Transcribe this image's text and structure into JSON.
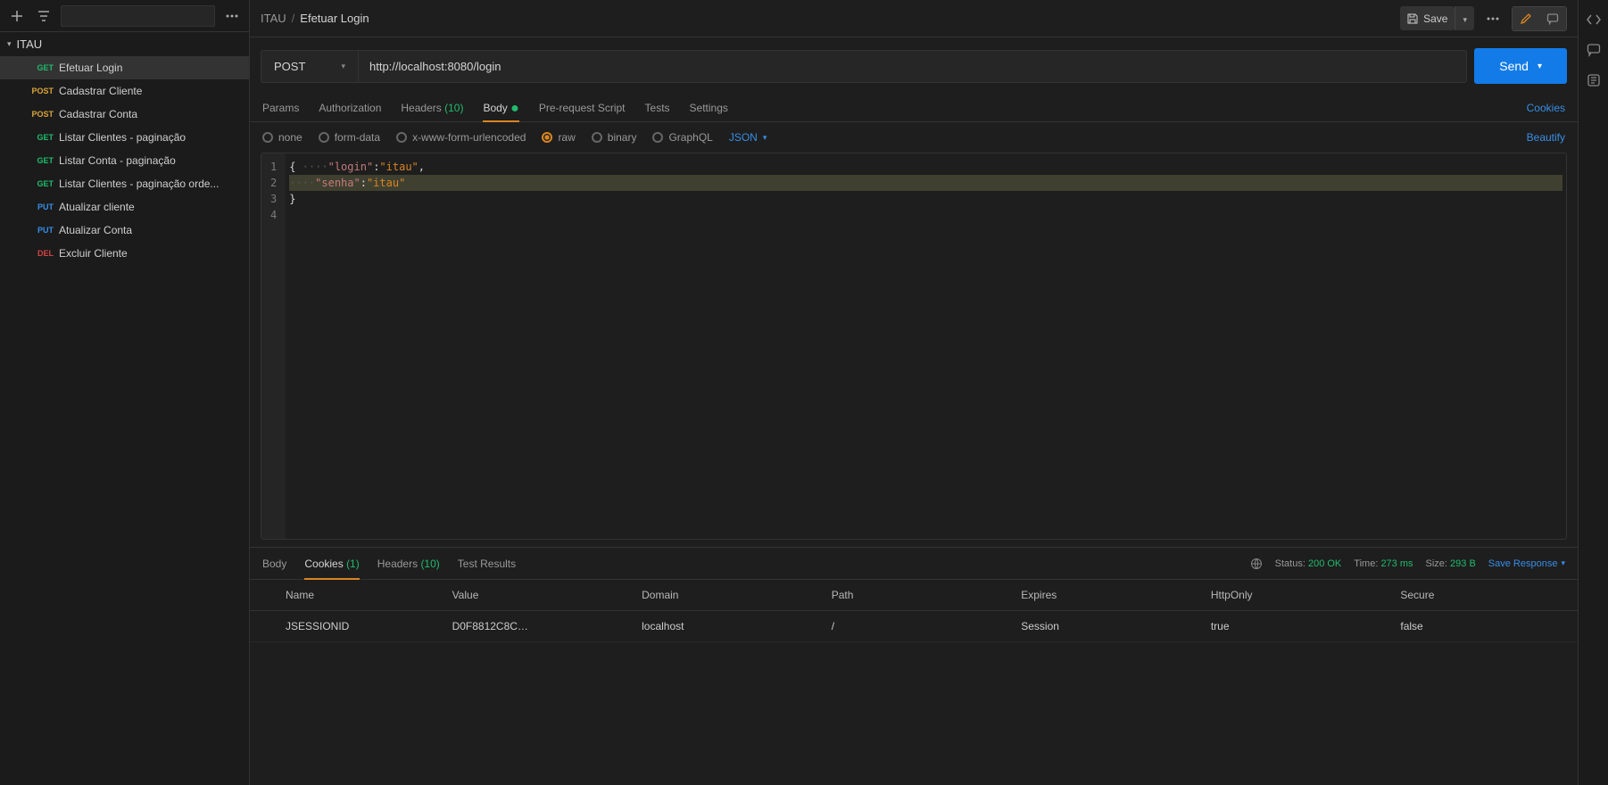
{
  "sidebar": {
    "collection_name": "ITAU",
    "items": [
      {
        "method": "GET",
        "label": "Efetuar Login",
        "active": true
      },
      {
        "method": "POST",
        "label": "Cadastrar Cliente"
      },
      {
        "method": "POST",
        "label": "Cadastrar Conta"
      },
      {
        "method": "GET",
        "label": "Listar Clientes - paginação"
      },
      {
        "method": "GET",
        "label": "Listar Conta - paginação"
      },
      {
        "method": "GET",
        "label": "Listar Clientes - paginação orde..."
      },
      {
        "method": "PUT",
        "label": "Atualizar cliente"
      },
      {
        "method": "PUT",
        "label": "Atualizar Conta"
      },
      {
        "method": "DEL",
        "label": "Excluir Cliente"
      }
    ]
  },
  "breadcrumb": {
    "parent": "ITAU",
    "sep": "/",
    "current": "Efetuar Login"
  },
  "save_label": "Save",
  "request": {
    "method": "POST",
    "url": "http://localhost:8080/login",
    "send_label": "Send"
  },
  "req_tabs": {
    "params": "Params",
    "auth": "Authorization",
    "headers": "Headers",
    "headers_count": "(10)",
    "body": "Body",
    "prereq": "Pre-request Script",
    "tests": "Tests",
    "settings": "Settings",
    "cookies_link": "Cookies"
  },
  "body_opts": {
    "none": "none",
    "formdata": "form-data",
    "xform": "x-www-form-urlencoded",
    "raw": "raw",
    "binary": "binary",
    "graphql": "GraphQL",
    "type": "JSON",
    "beautify": "Beautify"
  },
  "editor": {
    "line1": "{",
    "line2_ws": "····",
    "line2_key": "\"login\"",
    "line2_colon": ":",
    "line2_val": "\"itau\"",
    "line2_comma": ",",
    "line3_ws": "····",
    "line3_key": "\"senha\"",
    "line3_colon": ":",
    "line3_val": "\"itau\"",
    "line4": "}"
  },
  "resp_tabs": {
    "body": "Body",
    "cookies": "Cookies",
    "cookies_count": "(1)",
    "headers": "Headers",
    "headers_count": "(10)",
    "tests": "Test Results"
  },
  "resp_meta": {
    "status_label": "Status:",
    "status_value": "200 OK",
    "time_label": "Time:",
    "time_value": "273 ms",
    "size_label": "Size:",
    "size_value": "293 B",
    "save_response": "Save Response"
  },
  "cookie_headers": {
    "name": "Name",
    "value": "Value",
    "domain": "Domain",
    "path": "Path",
    "expires": "Expires",
    "httponly": "HttpOnly",
    "secure": "Secure"
  },
  "cookies": [
    {
      "name": "JSESSIONID",
      "value": "D0F8812C8C…",
      "domain": "localhost",
      "path": "/",
      "expires": "Session",
      "httponly": "true",
      "secure": "false"
    }
  ]
}
